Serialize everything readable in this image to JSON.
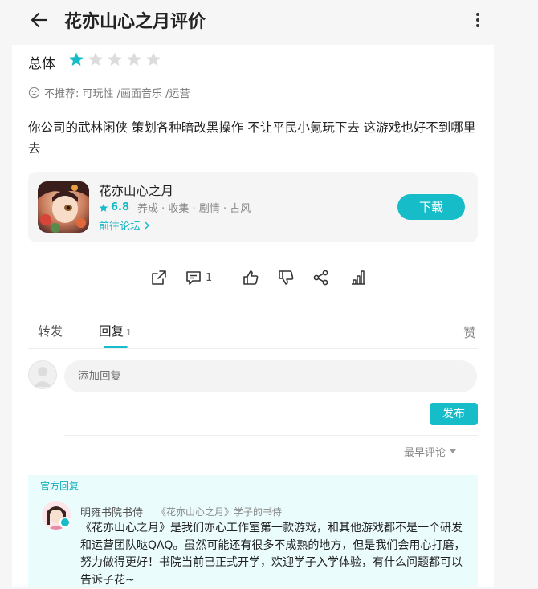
{
  "header": {
    "title": "花亦山心之月评价"
  },
  "rating": {
    "label": "总体",
    "stars": 1,
    "max_stars": 5,
    "star_color": "#17bcc9"
  },
  "not_recommended": {
    "text": "不推荐: 可玩性 /画面音乐 /运营"
  },
  "review": {
    "text": "你公司的武林闲侠 策划各种暗改黑操作 不让平民小氪玩下去 这游戏也好不到哪里去"
  },
  "game": {
    "name": "花亦山心之月",
    "score": "6.8",
    "tags": "养成 · 收集 · 剧情 · 古风",
    "forum_link": "前往论坛",
    "download_label": "下载"
  },
  "actions": {
    "comment_count": "1"
  },
  "tabs": {
    "repost": "转发",
    "reply": "回复",
    "reply_count": "1",
    "like": "赞"
  },
  "reply_box": {
    "placeholder": "添加回复",
    "publish_label": "发布"
  },
  "sort": {
    "label": "最早评论"
  },
  "official_reply": {
    "tag": "官方回复",
    "name": "明雍书院书侍",
    "sub": "《花亦山心之月》学子的书侍",
    "text": "《花亦山心之月》是我们亦心工作室第一款游戏，和其他游戏都不是一个研发和运营团队哒QAQ。虽然可能还有很多不成熟的地方，但是我们会用心打磨，努力做得更好！书院当前已正式开学，欢迎学子入学体验，有什么问题都可以告诉子花~"
  },
  "colors": {
    "accent": "#17bcc9",
    "official_bg": "#ebfcfd"
  }
}
